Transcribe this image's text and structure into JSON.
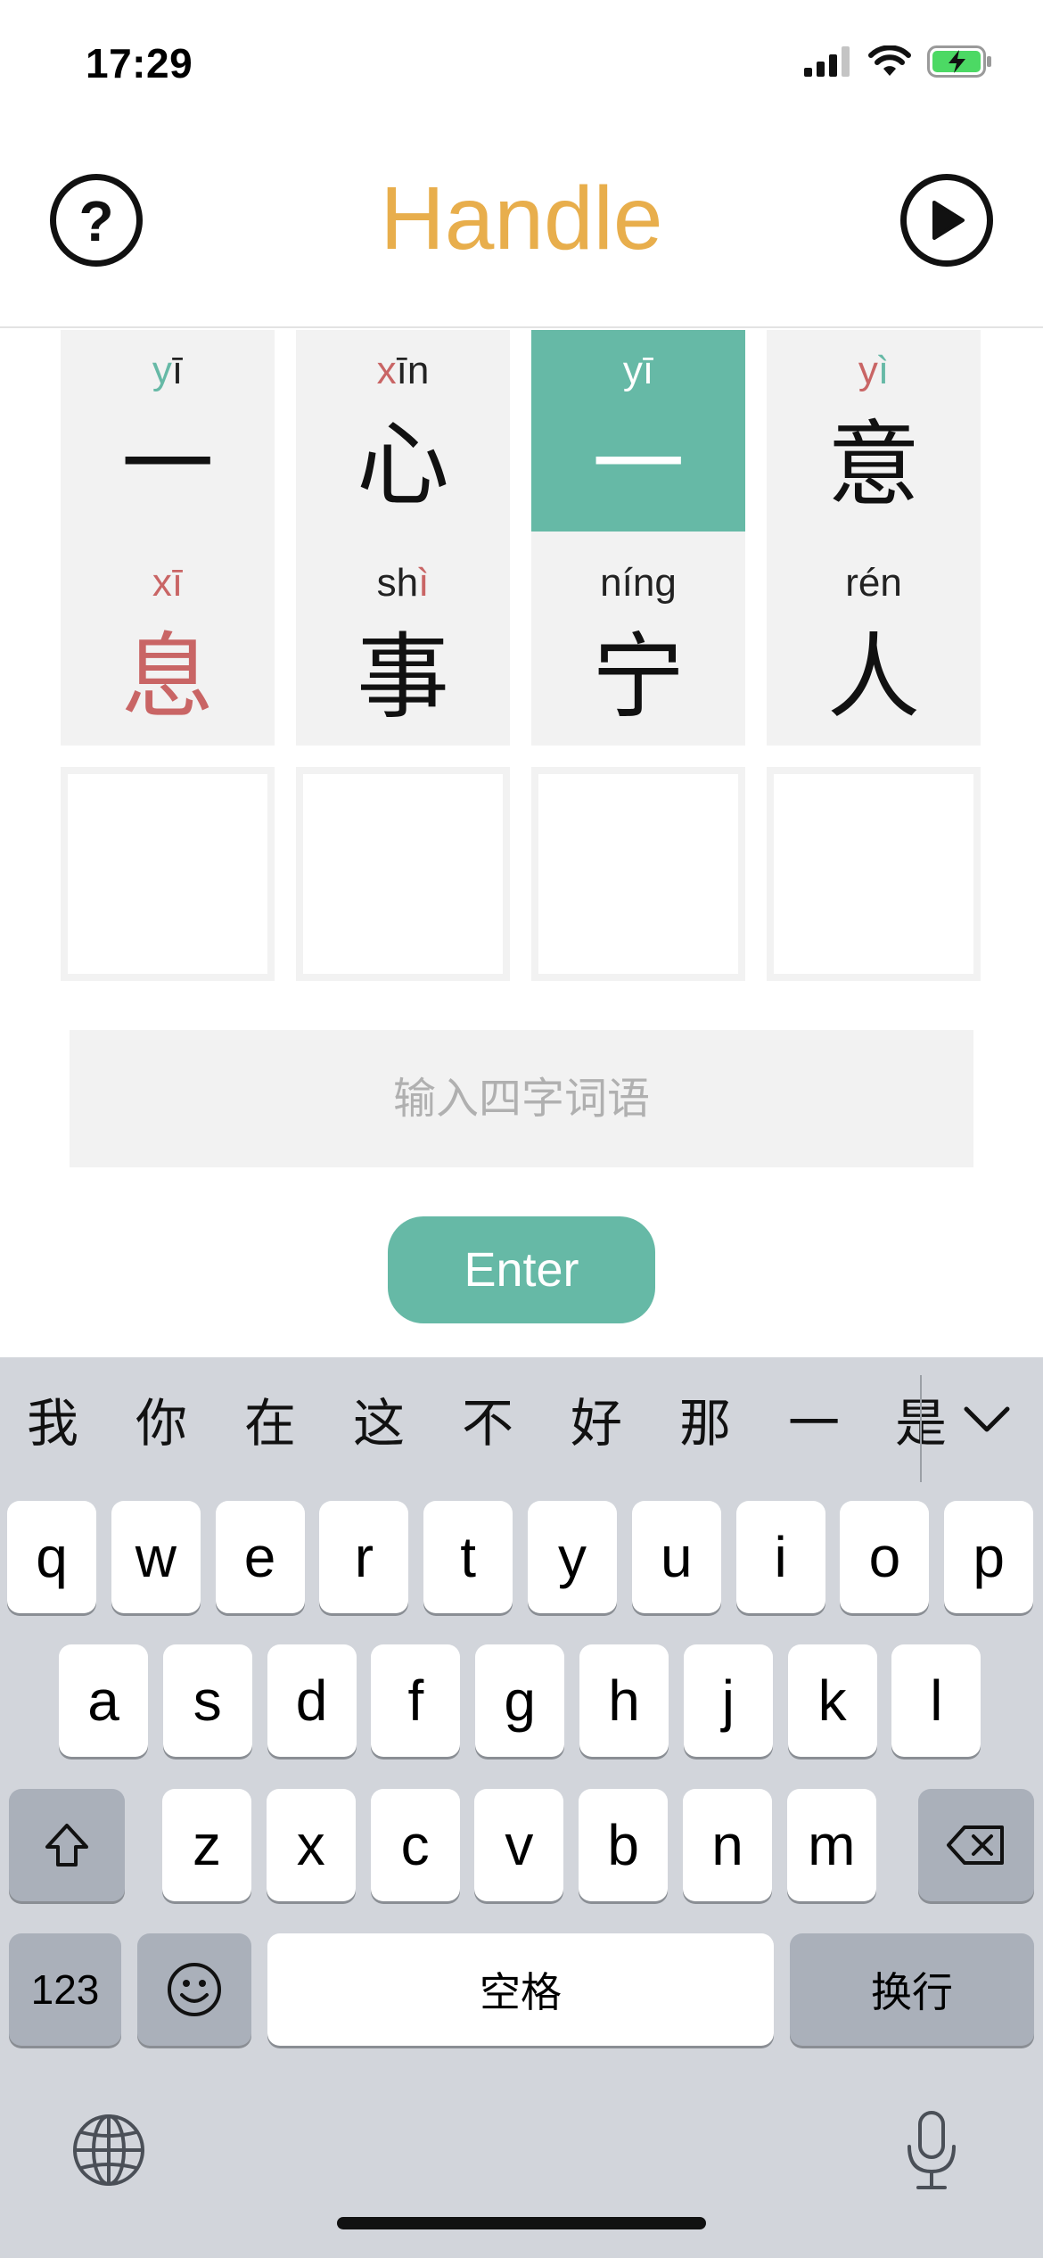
{
  "status_bar": {
    "time": "17:29"
  },
  "header": {
    "title": "Handle",
    "help_label": "?"
  },
  "board": {
    "rows": [
      [
        {
          "py_parts": [
            {
              "t": "y",
              "c": "c-green"
            },
            {
              "t": "ī",
              "c": ""
            }
          ],
          "hz": "一",
          "hz_color": "",
          "state": "absent"
        },
        {
          "py_parts": [
            {
              "t": "x",
              "c": "c-red"
            },
            {
              "t": "īn",
              "c": ""
            }
          ],
          "hz": "心",
          "hz_color": "",
          "state": "absent"
        },
        {
          "py_parts": [
            {
              "t": "yī",
              "c": ""
            }
          ],
          "hz": "一",
          "hz_color": "",
          "state": "correct"
        },
        {
          "py_parts": [
            {
              "t": "y",
              "c": "c-red"
            },
            {
              "t": "ì",
              "c": "c-green"
            }
          ],
          "hz": "意",
          "hz_color": "",
          "state": "absent"
        }
      ],
      [
        {
          "py_parts": [
            {
              "t": "xī",
              "c": "c-red"
            }
          ],
          "hz": "息",
          "hz_color": "c-red",
          "state": "present"
        },
        {
          "py_parts": [
            {
              "t": "sh",
              "c": ""
            },
            {
              "t": "ì",
              "c": "c-red"
            }
          ],
          "hz": "事",
          "hz_color": "",
          "state": "absent"
        },
        {
          "py_parts": [
            {
              "t": "níng",
              "c": ""
            }
          ],
          "hz": "宁",
          "hz_color": "",
          "state": "absent"
        },
        {
          "py_parts": [
            {
              "t": "rén",
              "c": ""
            }
          ],
          "hz": "人",
          "hz_color": "",
          "state": "absent"
        }
      ],
      [
        {
          "py_parts": [],
          "hz": "",
          "state": "empty"
        },
        {
          "py_parts": [],
          "hz": "",
          "state": "empty"
        },
        {
          "py_parts": [],
          "hz": "",
          "state": "empty"
        },
        {
          "py_parts": [],
          "hz": "",
          "state": "empty"
        }
      ]
    ]
  },
  "input": {
    "placeholder": "输入四字词语",
    "value": ""
  },
  "enter_label": "Enter",
  "keyboard": {
    "candidates": [
      "我",
      "你",
      "在",
      "这",
      "不",
      "好",
      "那",
      "一",
      "是"
    ],
    "row1": [
      "q",
      "w",
      "e",
      "r",
      "t",
      "y",
      "u",
      "i",
      "o",
      "p"
    ],
    "row2": [
      "a",
      "s",
      "d",
      "f",
      "g",
      "h",
      "j",
      "k",
      "l"
    ],
    "row3": [
      "z",
      "x",
      "c",
      "v",
      "b",
      "n",
      "m"
    ],
    "numbers_label": "123",
    "space_label": "空格",
    "return_label": "换行"
  },
  "colors": {
    "accent_green": "#66B9A6",
    "title_orange": "#E8AE4C",
    "miss_red": "#C96565"
  }
}
